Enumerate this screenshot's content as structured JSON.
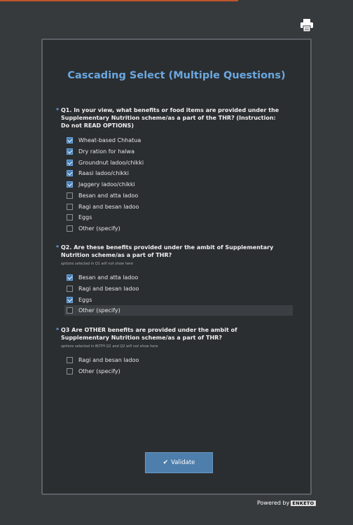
{
  "form": {
    "title": "Cascading Select (Multiple Questions)",
    "required_mark": "*"
  },
  "questions": [
    {
      "label": "Q1. In your view, what benefits or food items are provided under the Supplementary Nutrition scheme/as a part of the THR? (Instruction: Do not READ OPTIONS)",
      "hint": "",
      "options": [
        {
          "label": "Wheat-based Chhatua",
          "checked": true
        },
        {
          "label": "Dry ration for halwa",
          "checked": true
        },
        {
          "label": "Groundnut ladoo/chikki",
          "checked": true
        },
        {
          "label": "Raasi ladoo/chikki",
          "checked": true
        },
        {
          "label": "Jaggery ladoo/chikki",
          "checked": true
        },
        {
          "label": "Besan and atta ladoo",
          "checked": false
        },
        {
          "label": "Ragi and besan ladoo",
          "checked": false
        },
        {
          "label": "Eggs",
          "checked": false
        },
        {
          "label": "Other (specify)",
          "checked": false
        }
      ]
    },
    {
      "label": "Q2. Are these benefits provided under the ambit of Supplementary Nutrition scheme/as a part of THR?",
      "hint": "options selected in Q1 will not show here",
      "options": [
        {
          "label": "Besan and atta ladoo",
          "checked": true
        },
        {
          "label": "Ragi and besan ladoo",
          "checked": false
        },
        {
          "label": "Eggs",
          "checked": true
        },
        {
          "label": "Other (specify)",
          "checked": false
        }
      ]
    },
    {
      "label": "Q3 Are OTHER benefits are provided under the ambit of Supplementary Nutrition scheme/as a part of THR?",
      "hint": "options selected in BOTH Q1 and Q2 will not show here",
      "options": [
        {
          "label": "Ragi and besan ladoo",
          "checked": false
        },
        {
          "label": "Other (specify)",
          "checked": false
        }
      ]
    }
  ],
  "validate_label": "Validate",
  "validate_icon": "check-icon",
  "footer": {
    "powered_by": "Powered by",
    "logo_text": "ENKETO"
  },
  "colors": {
    "accent": "#6aa8e0",
    "button": "#4e7eab",
    "background": "#363a3d",
    "panel": "#2b2e31"
  }
}
